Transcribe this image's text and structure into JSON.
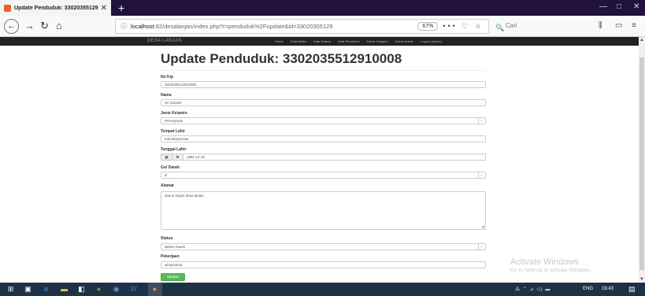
{
  "browser": {
    "tab_title": "Update Penduduk: 33020355129",
    "new_tab": "+",
    "url_prefix": "localhost",
    "url_rest": ":82/desalanjan/index.php?r=penduduk%2Fupdate&id=33020355129",
    "zoom": "67%",
    "url_actions": "••• ♡ ☆",
    "search_placeholder": "Cari",
    "window_minimize": "—",
    "window_restore": "□",
    "window_close": "✕"
  },
  "site": {
    "brand": "DESA LANJAN",
    "nav": [
      "Home",
      "Data Berita",
      "Data Gallery",
      "Data Penduduk",
      "Kelola Kategori",
      "Kelola Admin",
      "Logout (admin)"
    ]
  },
  "page": {
    "title": "Update Penduduk: 3302035512910008",
    "submit_label": "Simpan"
  },
  "form": {
    "nik_label": "No Kip",
    "nik_value": "3302035512910008",
    "nama_label": "Nama",
    "nama_value": "Sri Sulasih",
    "jk_label": "Jenis Kelamin",
    "jk_value": "Perempuan",
    "tempat_label": "Tempat Lahir",
    "tempat_value": "Kab.Banyumas",
    "tanggal_label": "Tanggal Lahir",
    "tanggal_value": "1991-12-15",
    "goldar_label": "Gol Darah",
    "goldar_value": "B",
    "alamat_label": "Alamat",
    "alamat_value": "dusun lanjan desa lanjan",
    "status_label": "Status",
    "status_value": "Belum Kawin",
    "pekerjaan_label": "Pekerjaan",
    "pekerjaan_value": "wiraswasta"
  },
  "watermark": {
    "title": "Activate Windows",
    "subtitle": "Go to Settings to activate Windows."
  },
  "taskbar": {
    "language": "ENG",
    "time": "19.43"
  },
  "icons": {
    "back": "back-icon",
    "forward": "forward-icon",
    "reload": "reload-icon",
    "home": "home-icon",
    "library": "library-icon",
    "sidebar": "sidebar-icon",
    "menu": "hamburger-icon"
  }
}
